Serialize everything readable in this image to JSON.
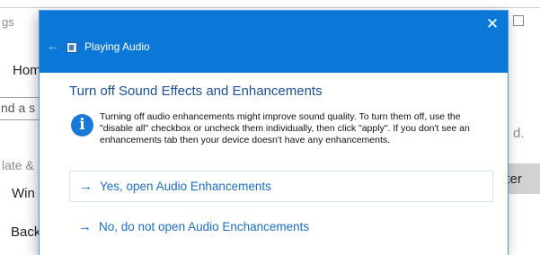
{
  "background_window": {
    "breadcrumb_fragment": "gs",
    "nav_home": "Hom",
    "search_fragment": "nd a s",
    "section_fragment": "late &",
    "nav_item_1": "Win",
    "nav_item_2": "Back",
    "right_text_fragment": "d.",
    "right_button_fragment": "oter"
  },
  "dialog": {
    "window_title": "Playing Audio",
    "close_icon": "✕",
    "back_icon": "←",
    "heading": "Turn off Sound Effects and Enhancements",
    "info_icon": "i",
    "info_text": "Turning off audio enhancements might improve sound quality. To turn them off, use the \"disable all\" checkbox or uncheck them individually, then click \"apply\". If you don't see an enhancements tab then your device doesn't have any enhancements.",
    "options": [
      {
        "arrow": "→",
        "label": "Yes, open Audio Enhancements"
      },
      {
        "arrow": "→",
        "label": "No, do not open Audio Enchancements"
      }
    ]
  },
  "colors": {
    "titlebar": "#0b78d7",
    "heading": "#1a4f9a",
    "link": "#1a6fc8"
  }
}
